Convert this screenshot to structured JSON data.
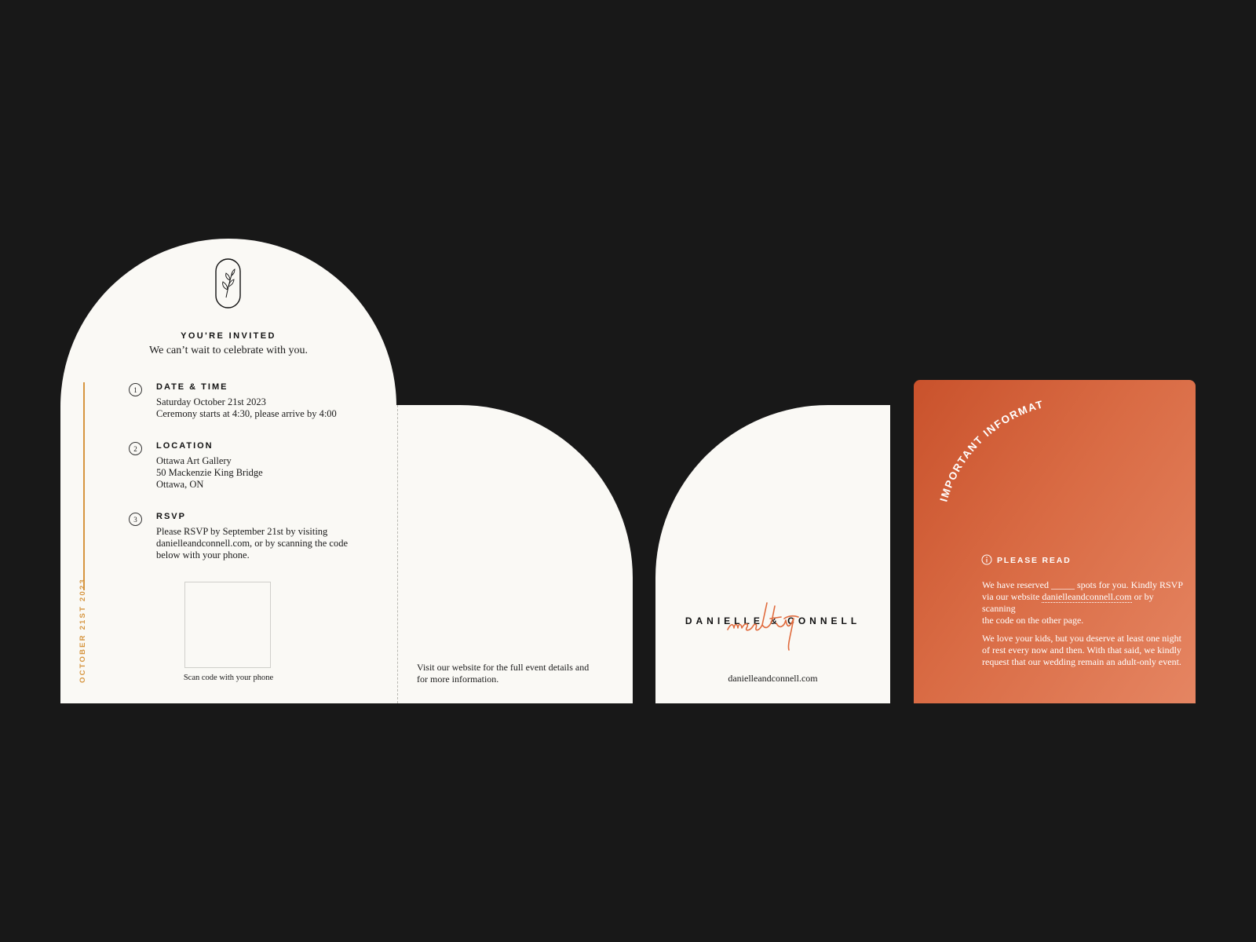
{
  "colors": {
    "background": "#181818",
    "paper": "#faf9f5",
    "accent_gold": "#d6953f",
    "accent_orange": "#d9633a"
  },
  "invite_card": {
    "heading": "YOU'RE INVITED",
    "subheading": "We can’t wait to celebrate with you.",
    "side_date": "OCTOBER 21ST 2023",
    "sections": [
      {
        "number": "1",
        "title": "DATE & TIME",
        "lines": [
          "Saturday October 21st 2023",
          "Ceremony starts at 4:30, please arrive by 4:00"
        ]
      },
      {
        "number": "2",
        "title": "LOCATION",
        "lines": [
          "Ottawa Art Gallery",
          "50 Mackenzie King Bridge",
          "Ottawa, ON"
        ]
      },
      {
        "number": "3",
        "title": "RSVP",
        "lines": [
          "Please RSVP by September 21st by visiting",
          "danielleandconnell.com, or by scanning the code",
          "below with your phone."
        ]
      }
    ],
    "qr_caption": "Scan code with your phone",
    "logo_icon": "leaf-sprig-icon"
  },
  "website_panel": {
    "lines": [
      "Visit our website for the full event details and",
      "for more information."
    ]
  },
  "names_panel": {
    "names": "DANIELLE & CONNELL",
    "script_signature": "mccarthy",
    "website": "danielleandconnell.com"
  },
  "info_card": {
    "arc_title": "IMPORTANT INFORMATION",
    "please_read": "PLEASE READ",
    "info_icon": "info-icon",
    "paragraph1": {
      "before": "We have reserved ",
      "blank": "_____",
      "after1": " spots for you. Kindly RSVP",
      "line2_before": "via our website ",
      "link": "danielleandconnell.com",
      "line2_after": " or by scanning",
      "line3": "the code on the other page."
    },
    "paragraph2": [
      "We love your kids, but you deserve at least one night",
      "of rest every now and then. With that said, we kindly",
      "request that our wedding remain an adult-only event."
    ]
  }
}
